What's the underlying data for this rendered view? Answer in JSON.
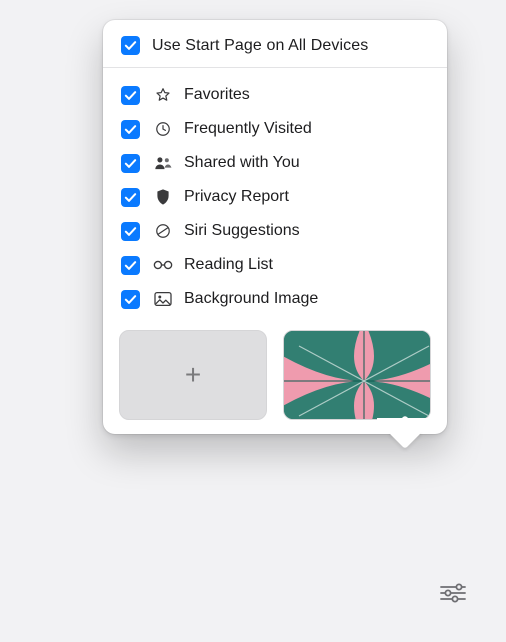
{
  "colors": {
    "accent": "#0a7aff"
  },
  "header": {
    "checked": true,
    "label": "Use Start Page on All Devices"
  },
  "options": [
    {
      "checked": true,
      "icon": "star-outline-icon",
      "label": "Favorites"
    },
    {
      "checked": true,
      "icon": "clock-icon",
      "label": "Frequently Visited"
    },
    {
      "checked": true,
      "icon": "people-icon",
      "label": "Shared with You"
    },
    {
      "checked": true,
      "icon": "shield-icon",
      "label": "Privacy Report"
    },
    {
      "checked": true,
      "icon": "siri-icon",
      "label": "Siri Suggestions"
    },
    {
      "checked": true,
      "icon": "glasses-icon",
      "label": "Reading List"
    },
    {
      "checked": true,
      "icon": "image-icon",
      "label": "Background Image"
    }
  ],
  "thumbnails": {
    "add_label": "+",
    "preview_name": "butterfly-wallpaper"
  },
  "footer": {
    "settings_name": "settings"
  }
}
